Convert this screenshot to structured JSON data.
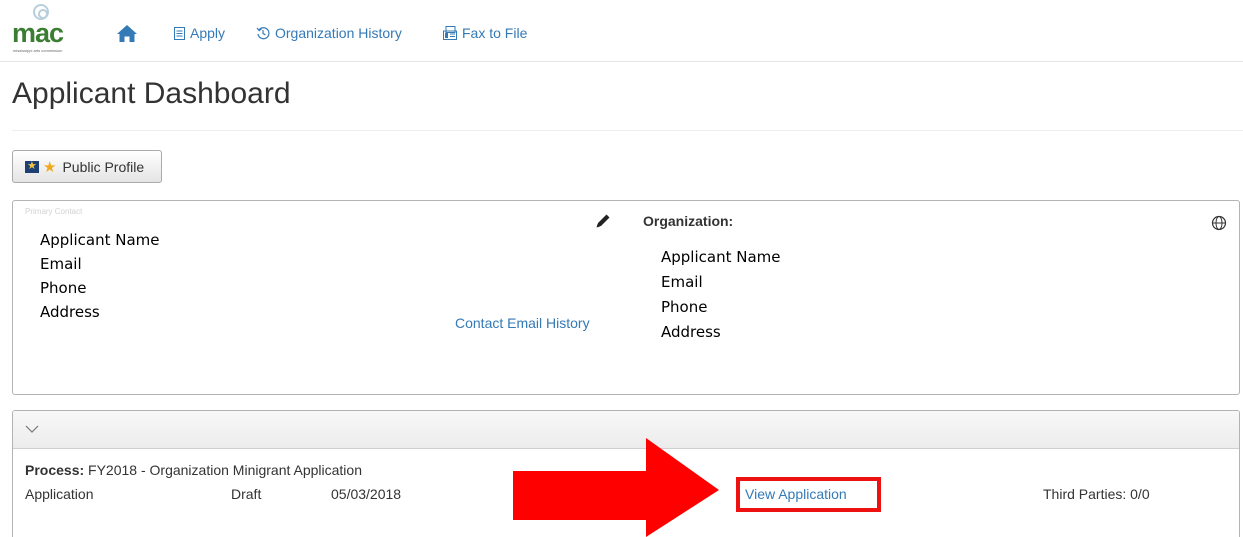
{
  "brand": {
    "logo_text": "mac",
    "logo_tagline": "mississippi arts commission"
  },
  "nav": {
    "items": [
      {
        "label": "Apply",
        "icon": "document-icon"
      },
      {
        "label": "Organization History",
        "icon": "history-icon"
      },
      {
        "label": "Fax to File",
        "icon": "fax-icon"
      }
    ]
  },
  "page": {
    "title": "Applicant Dashboard"
  },
  "toolbar": {
    "public_profile_label": "Public Profile"
  },
  "contact": {
    "faint_label": "Primary Contact",
    "lines": [
      "Applicant Name",
      "Email",
      "Phone",
      "Address"
    ],
    "email_history_label": "Contact Email History"
  },
  "organization": {
    "label": "Organization:",
    "lines": [
      "Applicant Name",
      "Email",
      "Phone",
      "Address"
    ]
  },
  "process": {
    "label": "Process:",
    "name": "FY2018 - Organization Minigrant Application",
    "row": {
      "type": "Application",
      "status": "Draft",
      "date": "05/03/2018",
      "view_label": "View Application",
      "third_parties": "Third Parties: 0/0"
    }
  },
  "colors": {
    "link": "#337ab7",
    "brand_green": "#3a7d33",
    "highlight_red": "#ee1111"
  }
}
